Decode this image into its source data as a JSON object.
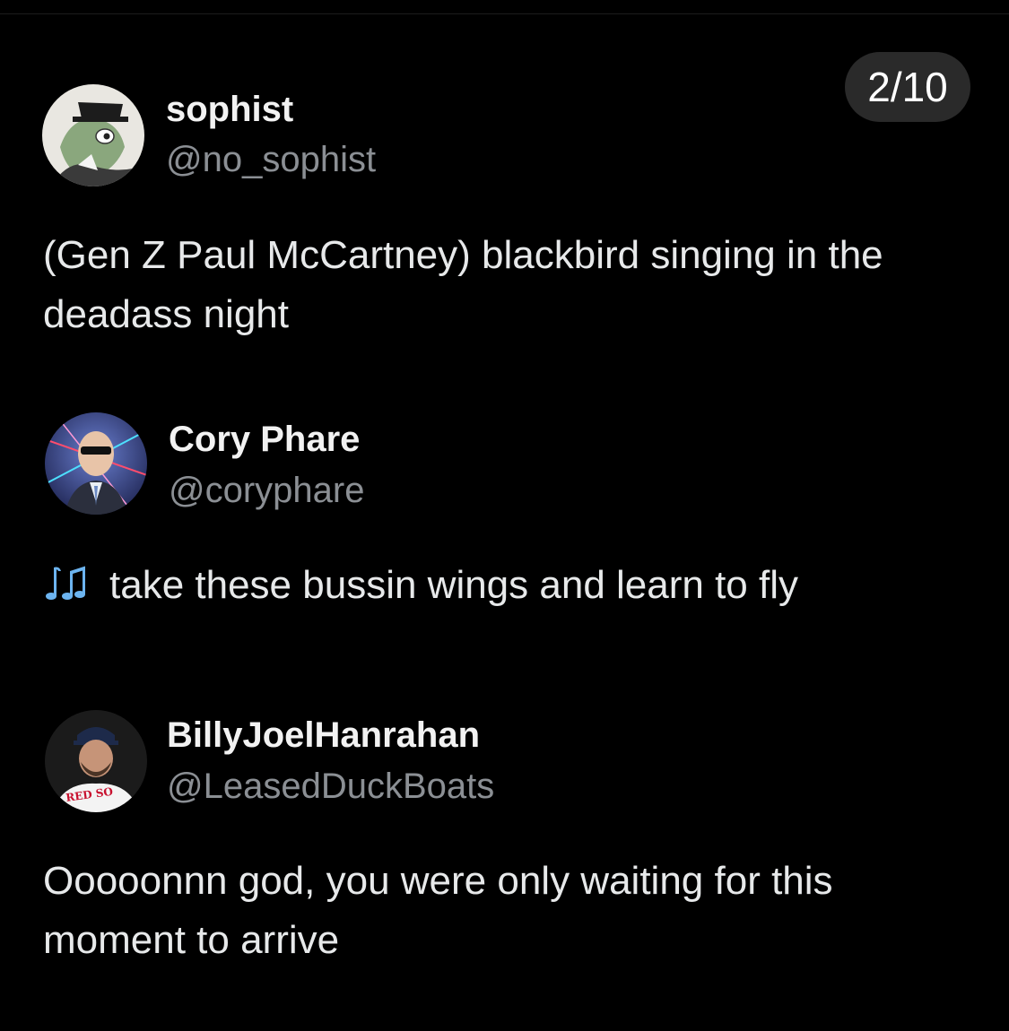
{
  "counter": "2/10",
  "posts": [
    {
      "name": "sophist",
      "handle": "@no_sophist",
      "text": "(Gen Z Paul McCartney) blackbird singing in the deadass night",
      "avatar_icon": "frog-in-top-hat-avatar"
    },
    {
      "name": "Cory Phare",
      "handle": "@coryphare",
      "text": "take these bussin wings and learn to fly",
      "prefix_icon": "music-notes-icon",
      "avatar_icon": "man-with-sunglasses-laser-background-avatar"
    },
    {
      "name": "BillyJoelHanrahan",
      "handle": "@LeasedDuckBoats",
      "text": "Ooooonnn god, you were only waiting for this moment to arrive",
      "avatar_icon": "red-sox-player-avatar",
      "avatar_jersey_text": "RED SO"
    }
  ],
  "colors": {
    "background": "#000000",
    "text": "#e7e9ea",
    "handle": "#8b8f94",
    "counter_bg": "#2a2a2a",
    "note_icon": "#6cb4f0"
  }
}
